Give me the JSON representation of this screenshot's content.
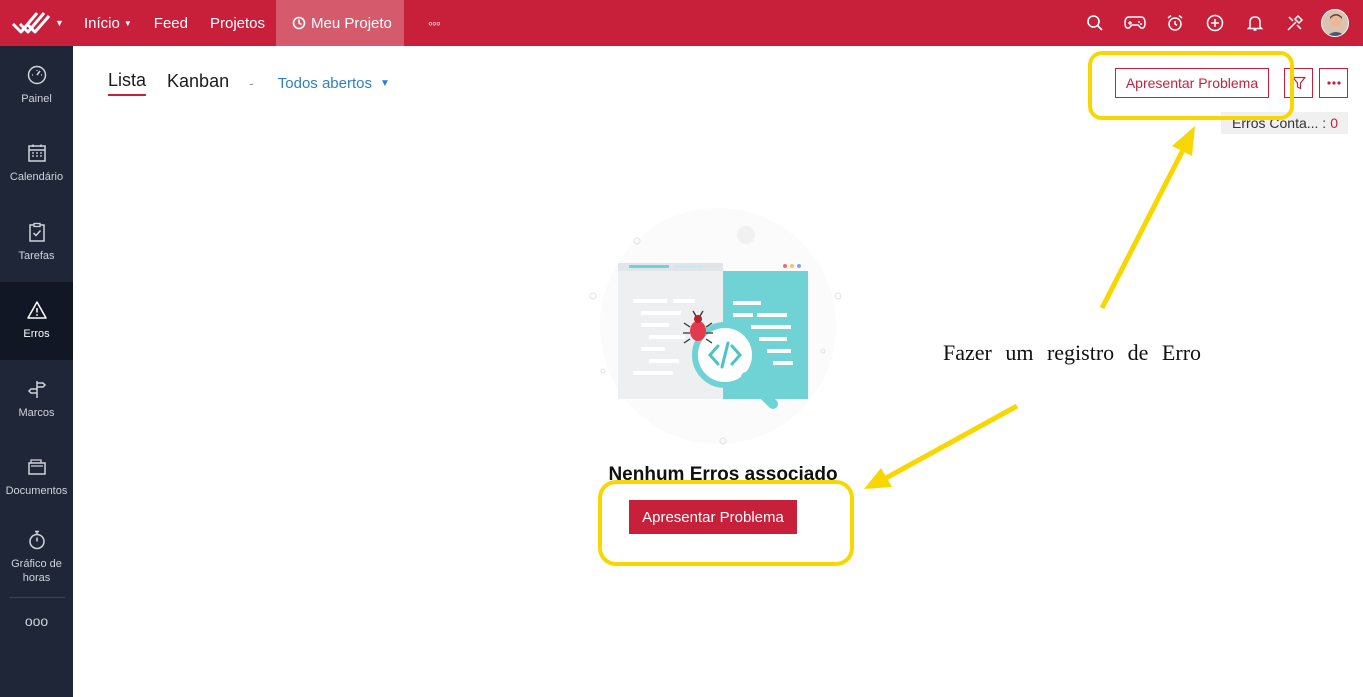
{
  "topbar": {
    "nav": [
      {
        "label": "Início",
        "caret": "▾"
      },
      {
        "label": "Feed"
      },
      {
        "label": "Projetos"
      }
    ],
    "active_project": "Meu Projeto",
    "more": "◦◦◦",
    "icons": [
      "search-icon",
      "gamepad-icon",
      "alarm-icon",
      "plus-circle-icon",
      "bell-icon",
      "tools-icon"
    ]
  },
  "sidebar": {
    "items": [
      {
        "label": "Painel",
        "icon": "dashboard-icon"
      },
      {
        "label": "Calendário",
        "icon": "calendar-icon"
      },
      {
        "label": "Tarefas",
        "icon": "clipboard-check-icon"
      },
      {
        "label": "Erros",
        "icon": "warning-icon"
      },
      {
        "label": "Marcos",
        "icon": "signpost-icon"
      },
      {
        "label": "Documentos",
        "icon": "folder-icon"
      },
      {
        "label": "Gráfico de horas",
        "icon": "stopwatch-icon"
      }
    ],
    "more": "ooo"
  },
  "main": {
    "tabs": [
      "Lista",
      "Kanban"
    ],
    "separator": "-",
    "filter_label": "Todos abertos",
    "report_button": "Apresentar Problema",
    "count_label": "Erros Conta... :",
    "count_value": "0",
    "empty_title": "Nenhum Erros associado",
    "empty_button": "Apresentar Problema"
  },
  "annotation": {
    "text": "Fazer um registro de Erro",
    "color": "#f8d700"
  },
  "colors": {
    "brand": "#c8203b",
    "sidebar": "#1f2638",
    "link": "#2e7fcb"
  }
}
